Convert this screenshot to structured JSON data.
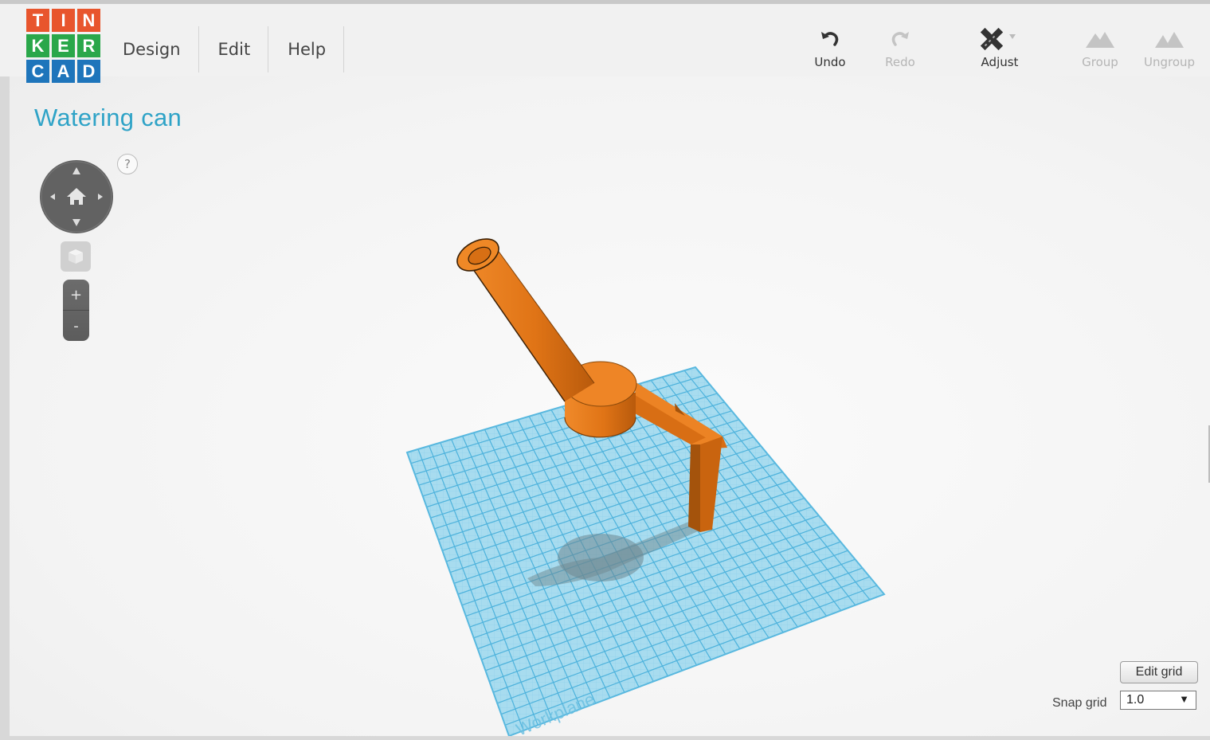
{
  "logo": {
    "letters": [
      "T",
      "I",
      "N",
      "K",
      "E",
      "R",
      "C",
      "A",
      "D"
    ],
    "colors": [
      "#e8552d",
      "#e8552d",
      "#e8552d",
      "#2aa74a",
      "#2aa74a",
      "#2aa74a",
      "#1e75bb",
      "#1e75bb",
      "#1e75bb"
    ]
  },
  "menu": [
    {
      "label": "Design"
    },
    {
      "label": "Edit"
    },
    {
      "label": "Help"
    }
  ],
  "toolbar": {
    "undo": {
      "label": "Undo",
      "icon": "undo-icon"
    },
    "redo": {
      "label": "Redo",
      "icon": "redo-icon",
      "disabled": true
    },
    "adjust": {
      "label": "Adjust",
      "icon": "adjust-icon"
    },
    "group": {
      "label": "Group",
      "icon": "group-icon",
      "disabled": true
    },
    "ungroup": {
      "label": "Ungroup",
      "icon": "ungroup-icon",
      "disabled": true
    }
  },
  "design": {
    "title": "Watering can"
  },
  "navigation": {
    "help": "?",
    "zoom_in": "+",
    "zoom_out": "-"
  },
  "workplane": {
    "label": "Workplane"
  },
  "grid_controls": {
    "edit_grid_label": "Edit grid",
    "snap_label": "Snap grid",
    "snap_value": "1.0",
    "dropdown_arrow": "▼"
  },
  "colors": {
    "accent": "#2fa3c7",
    "object": "#e87820",
    "workplane": "#8fd2ea"
  }
}
